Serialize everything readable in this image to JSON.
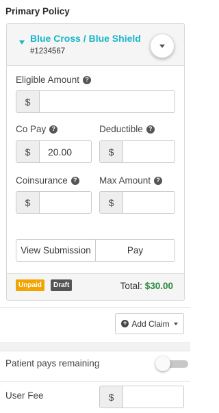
{
  "section_title": "Primary Policy",
  "policy": {
    "insurer_name": "Blue Cross / Blue Shield",
    "policy_number": "#1234567",
    "fields": {
      "eligible_amount": {
        "label": "Eligible Amount",
        "addon": "$",
        "value": ""
      },
      "co_pay": {
        "label": "Co Pay",
        "addon": "$",
        "value": "20.00"
      },
      "deductible": {
        "label": "Deductible",
        "addon": "$",
        "value": ""
      },
      "coinsurance": {
        "label": "Coinsurance",
        "addon": "$",
        "value": ""
      },
      "max_amount": {
        "label": "Max Amount",
        "addon": "$",
        "value": ""
      }
    },
    "help_glyph": "?",
    "buttons": {
      "view_submission": "View Submission",
      "pay": "Pay"
    },
    "badges": {
      "unpaid": "Unpaid",
      "draft": "Draft"
    },
    "total_label": "Total:",
    "total_amount": "$30.00"
  },
  "add_claim": {
    "label": "Add Claim",
    "plus_glyph": "+"
  },
  "patient_pays_remaining": {
    "label": "Patient pays remaining",
    "enabled": false
  },
  "user_fee": {
    "label": "User Fee",
    "addon": "$",
    "value": ""
  },
  "colors": {
    "accent": "#17b6c9",
    "unpaid": "#f2a400",
    "draft": "#555555",
    "total": "#2a8a3a"
  }
}
